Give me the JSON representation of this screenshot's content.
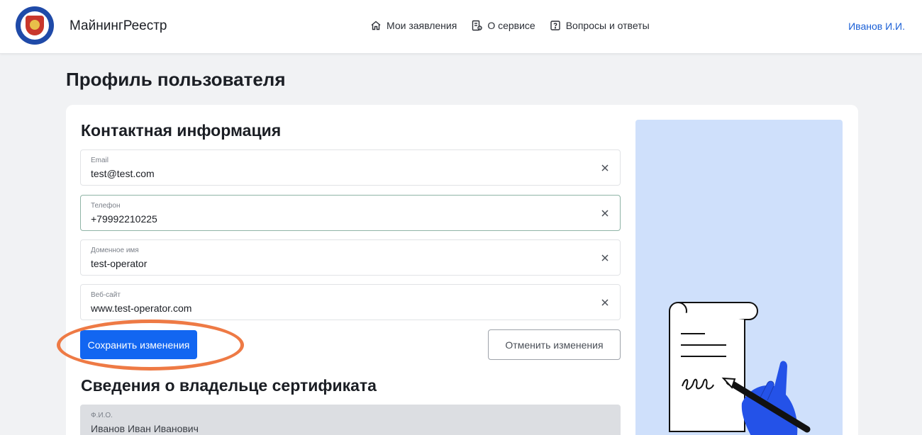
{
  "header": {
    "brand": "МайнингРеестр",
    "nav": [
      {
        "label": "Мои заявления",
        "icon": "home-icon"
      },
      {
        "label": "О сервисе",
        "icon": "document-info-icon"
      },
      {
        "label": "Вопросы и ответы",
        "icon": "question-icon"
      }
    ],
    "user": "Иванов И.И."
  },
  "page_title": "Профиль пользователя",
  "contact": {
    "title": "Контактная информация",
    "fields": [
      {
        "label": "Email",
        "value": "test@test.com"
      },
      {
        "label": "Телефон",
        "value": "+79992210225"
      },
      {
        "label": "Доменное имя",
        "value": "test-operator"
      },
      {
        "label": "Веб-сайт",
        "value": "www.test-operator.com"
      }
    ],
    "save_label": "Сохранить изменения",
    "cancel_label": "Отменить изменения"
  },
  "owner": {
    "title": "Сведения о владельце сертификата",
    "fields": [
      {
        "label": "Ф.И.О.",
        "value": "Иванов Иван Иванович"
      }
    ]
  },
  "colors": {
    "primary": "#1266f1",
    "highlight": "#ee7a45",
    "illustration_bg": "#cfe0fb",
    "link": "#1a5fd6"
  }
}
